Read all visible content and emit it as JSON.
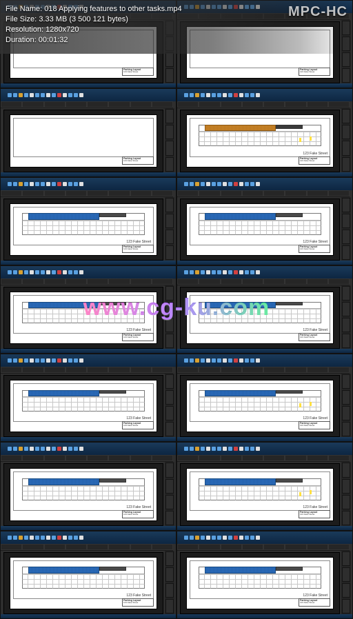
{
  "app_name": "MPC-HC",
  "overlay": {
    "file_name_label": "File Name:",
    "file_name": "018 Applying features to other tasks.mp4",
    "file_size_label": "File Size:",
    "file_size": "3.33 MB (3 500 121 bytes)",
    "resolution_label": "Resolution:",
    "resolution": "1280x720",
    "duration_label": "Duration:",
    "duration": "00:01:32"
  },
  "watermark": "www.cg-ku.com",
  "titleblock": {
    "heading": "Parking Layout",
    "sub": "123 Fake Street"
  },
  "thumbs": [
    {
      "paper": true,
      "plan": false
    },
    {
      "paper": true,
      "plan": false
    },
    {
      "paper": true,
      "plan": false
    },
    {
      "paper": true,
      "plan": true,
      "variant": "orange",
      "marks": true
    },
    {
      "paper": true,
      "plan": true,
      "variant": "blue"
    },
    {
      "paper": true,
      "plan": true,
      "variant": "blue"
    },
    {
      "paper": true,
      "plan": true,
      "variant": "blue"
    },
    {
      "paper": true,
      "plan": true,
      "variant": "blue"
    },
    {
      "paper": true,
      "plan": true,
      "variant": "blue"
    },
    {
      "paper": true,
      "plan": true,
      "variant": "blue",
      "marks": true
    },
    {
      "paper": true,
      "plan": true,
      "variant": "blue"
    },
    {
      "paper": true,
      "plan": true,
      "variant": "blue",
      "marks": true
    },
    {
      "paper": true,
      "plan": true,
      "variant": "blue"
    },
    {
      "paper": true,
      "plan": true,
      "variant": "blue"
    }
  ]
}
